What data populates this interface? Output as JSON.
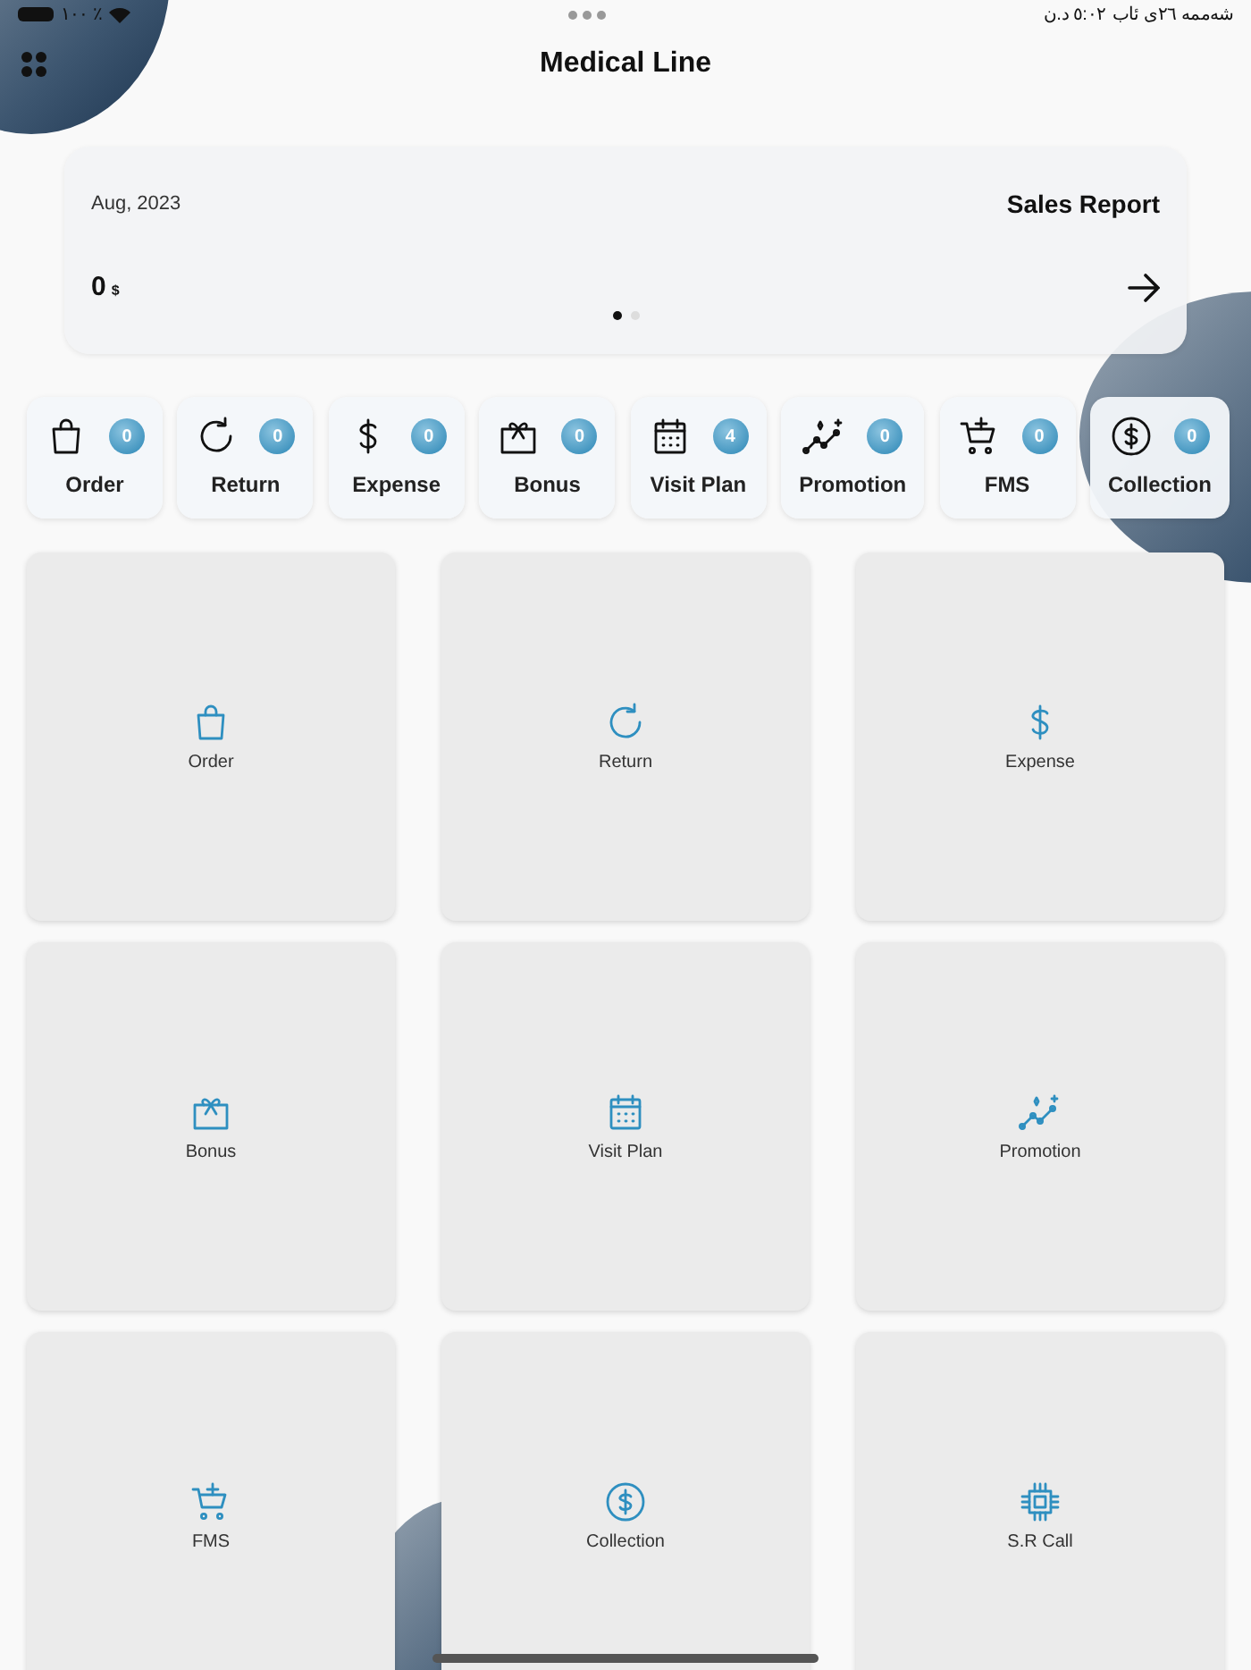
{
  "status_bar": {
    "battery": "١٠٠ ٪",
    "date": "شەممە ٢٦ی ئاب",
    "time": "٥:٠٢ د.ن"
  },
  "header": {
    "title": "Medical Line"
  },
  "sales_card": {
    "date": "Aug, 2023",
    "title": "Sales Report",
    "amount": "0",
    "currency": "$",
    "pages": [
      {
        "selected": true
      },
      {
        "selected": false
      }
    ]
  },
  "shortcuts": [
    {
      "kind": "bag",
      "label": "Order",
      "count": "0"
    },
    {
      "kind": "return",
      "label": "Return",
      "count": "0"
    },
    {
      "kind": "dollar",
      "label": "Expense",
      "count": "0"
    },
    {
      "kind": "gift",
      "label": "Bonus",
      "count": "0"
    },
    {
      "kind": "calendar",
      "label": "Visit Plan",
      "count": "4"
    },
    {
      "kind": "chart",
      "label": "Promotion",
      "count": "0"
    },
    {
      "kind": "cart",
      "label": "FMS",
      "count": "0"
    },
    {
      "kind": "coin",
      "label": "Collection",
      "count": "0"
    }
  ],
  "tiles": [
    {
      "kind": "bag",
      "label": "Order"
    },
    {
      "kind": "return",
      "label": "Return"
    },
    {
      "kind": "dollar",
      "label": "Expense"
    },
    {
      "kind": "gift",
      "label": "Bonus"
    },
    {
      "kind": "calendar",
      "label": "Visit Plan"
    },
    {
      "kind": "chart",
      "label": "Promotion"
    },
    {
      "kind": "cart",
      "label": "FMS"
    },
    {
      "kind": "coin",
      "label": "Collection"
    },
    {
      "kind": "chip",
      "label": "S.R Call"
    }
  ]
}
